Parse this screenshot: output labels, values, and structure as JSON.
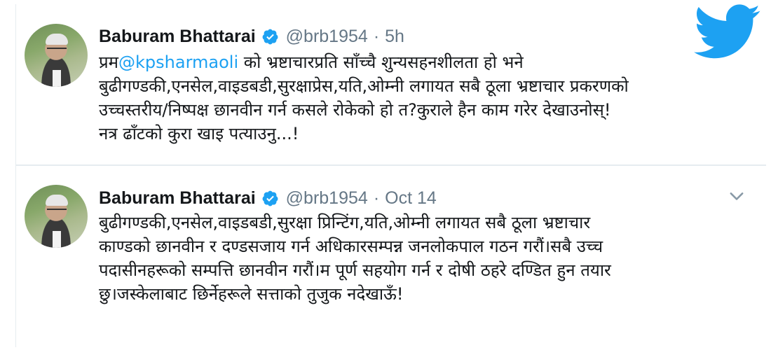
{
  "brand": {
    "logo_icon": "twitter-bird-icon",
    "color": "#1da1f2"
  },
  "tweets": [
    {
      "author": {
        "name": "Baburam Bhattarai",
        "handle": "@brb1954",
        "verified": true
      },
      "dot": "·",
      "time": "5h",
      "text": {
        "prefix": "प्रम",
        "mention": "@kpsharmaoli",
        "line1_rest": " को भ्रष्टाचारप्रति साँच्चै शुन्यसहनशीलता हो भने",
        "line2": "बुढीगण्डकी,एनसेल,वाइडबडी,सुरक्षाप्रेस,यति,ओम्नी लगायत सबै ठूला भ्रष्टाचार प्रकरणको",
        "line3": "उच्चस्तरीय/निष्पक्ष छानवीन गर्न कसले रोकेको हो त?कुराले हैन काम गरेर देखाउनोस्!",
        "line4": "नत्र ढाँटको कुरा खाइ पत्याउनु...!"
      }
    },
    {
      "author": {
        "name": "Baburam Bhattarai",
        "handle": "@brb1954",
        "verified": true
      },
      "dot": "·",
      "time": "Oct 14",
      "menu_icon": "chevron-down-icon",
      "text": {
        "line1": "बुढीगण्डकी,एनसेल,वाइडबडी,सुरक्षा प्रिन्टिंग,यति,ओम्नी लगायत सबै ठूला भ्रष्टाचार",
        "line2": "काण्डको छानवीन र दण्डसजाय गर्न अधिकारसम्पन्न जनलोकपाल गठन गरौं।सबै उच्च",
        "line3": "पदासीनहरूको सम्पत्ति छानवीन गरौं।म पूर्ण सहयोग गर्न र दोषी ठहरे दण्डित हुन तयार",
        "line4": "छु।जस्केलाबाट छिर्नेहरूले सत्ताको तुजुक नदेखाऊँ!"
      }
    }
  ]
}
